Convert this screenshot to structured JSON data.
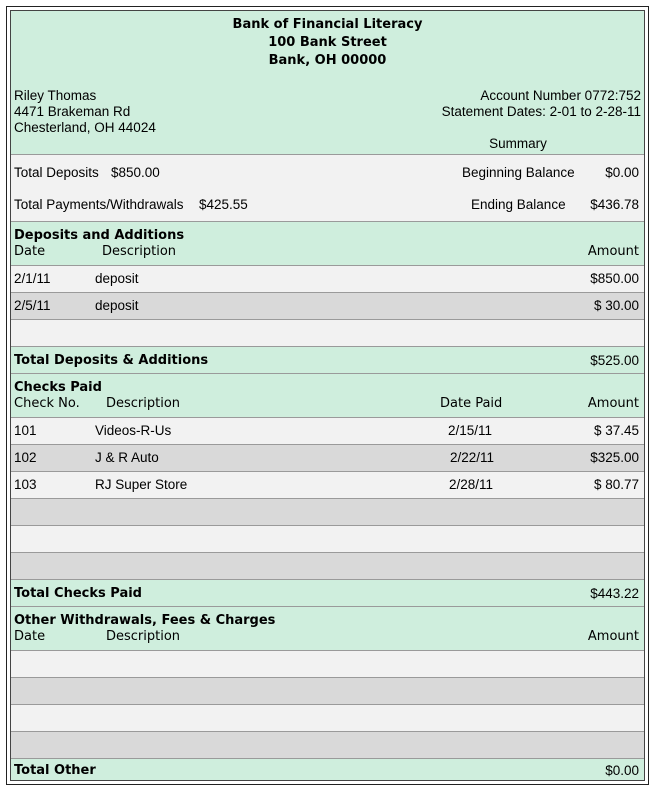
{
  "bank": {
    "name": "Bank of Financial Literacy",
    "street": "100 Bank Street",
    "city": "Bank, OH 00000"
  },
  "customer": {
    "name": "Riley Thomas",
    "street": "4471 Brakeman Rd",
    "city": "Chesterland, OH 44024"
  },
  "account": {
    "number": "Account Number 0772:752",
    "dates": "Statement Dates: 2-01 to 2-28-11"
  },
  "summary": {
    "title": "Summary",
    "total_deposits_label": "Total Deposits",
    "total_deposits_value": "$850.00",
    "beginning_balance_label": "Beginning Balance",
    "beginning_balance_value": "$0.00",
    "total_payments_label": "Total Payments/Withdrawals",
    "total_payments_value": "$425.55",
    "ending_balance_label": "Ending Balance",
    "ending_balance_value": "$436.78"
  },
  "deposits": {
    "title": "Deposits and Additions",
    "col_date": "Date",
    "col_description": "Description",
    "col_amount": "Amount",
    "rows": [
      {
        "date": "2/1/11",
        "description": "deposit",
        "amount": "$850.00"
      },
      {
        "date": "2/5/11",
        "description": "deposit",
        "amount": "$ 30.00"
      }
    ],
    "total_label": "Total Deposits & Additions",
    "total_value": "$525.00"
  },
  "checks": {
    "title": "Checks Paid",
    "col_check_no": "Check No.",
    "col_description": "Description",
    "col_date_paid": "Date Paid",
    "col_amount": "Amount",
    "rows": [
      {
        "check_no": "101",
        "description": "Videos-R-Us",
        "date_paid": "2/15/11",
        "amount": "$ 37.45"
      },
      {
        "check_no": "102",
        "description": "J & R Auto",
        "date_paid": "2/22/11",
        "amount": "$325.00"
      },
      {
        "check_no": "103",
        "description": "RJ Super Store",
        "date_paid": "2/28/11",
        "amount": "$ 80.77"
      }
    ],
    "total_label": "Total Checks Paid",
    "total_value": "$443.22"
  },
  "other": {
    "title": "Other Withdrawals, Fees & Charges",
    "col_date": "Date",
    "col_description": "Description",
    "col_amount": "Amount",
    "total_label": "Total Other",
    "total_value": "$0.00"
  }
}
